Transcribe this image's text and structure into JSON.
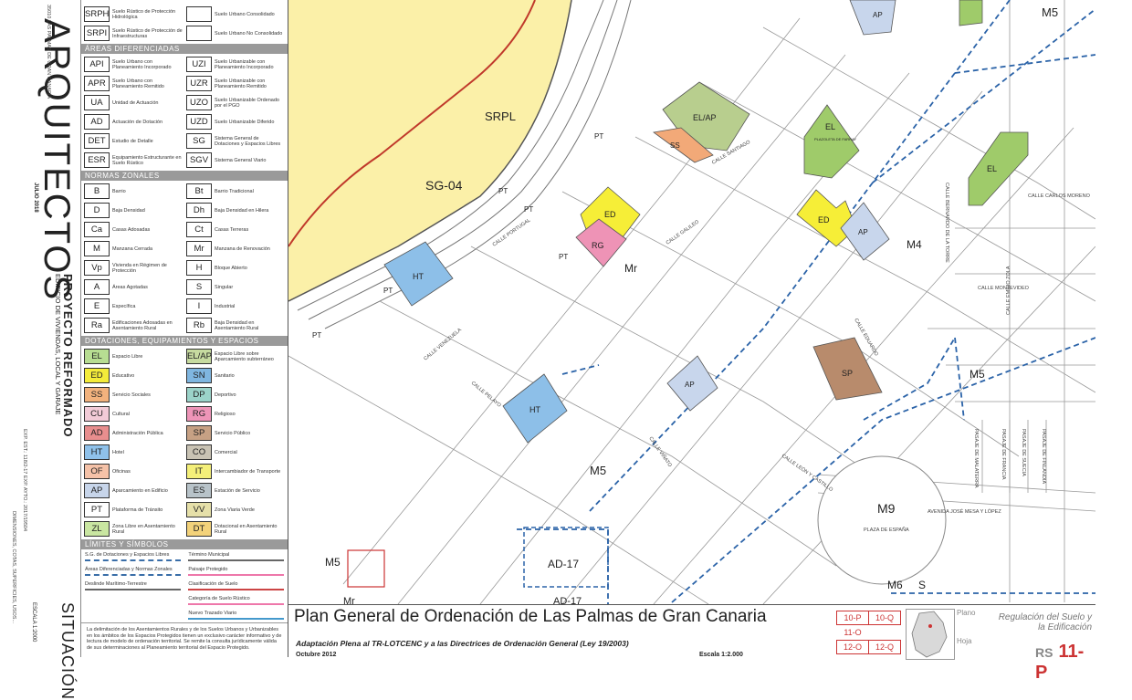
{
  "strip": {
    "brand": "ARQUITECTOS",
    "project": "PROYECTO REFORMADO",
    "building": "EDIFICIO DE VIVIENDAS, LOCAL Y GARAJE",
    "address": "35010 LAS PALMAS DE GRAN CANARIA",
    "date": "JULIO 2018",
    "file": "EXP. EST.: 118/2-17   EXP. AYTO.: 2017/19504",
    "measures": "DIMENSIONES, COTAS, SUPERFICIES, USOS...",
    "situacion": "SITUACIÓN",
    "scale": "ESCALA 1:2000"
  },
  "legend": {
    "top_rows": [
      {
        "code": "SRPH",
        "desc": "Suelo Rústico de Protección Hidrológica",
        "code2": "",
        "desc2": "Suelo Urbano Consolidado",
        "color2": "#ffffff"
      },
      {
        "code": "SRPI",
        "desc": "Suelo Rústico de Protección de Infraestructuras",
        "code2": "",
        "desc2": "Suelo Urbano No Consolidado",
        "color2": "#ffffff"
      }
    ],
    "areas_header": "Áreas Diferenciadas",
    "areas": [
      {
        "code": "API",
        "desc": "Suelo Urbano con Planeamiento Incorporado"
      },
      {
        "code": "UZI",
        "desc": "Suelo Urbanizable con Planeamiento Incorporado"
      },
      {
        "code": "APR",
        "desc": "Suelo Urbano con Planeamiento Remitido"
      },
      {
        "code": "UZR",
        "desc": "Suelo Urbanizable con Planeamiento Remitido"
      },
      {
        "code": "UA",
        "desc": "Unidad de Actuación"
      },
      {
        "code": "UZO",
        "desc": "Suelo Urbanizable Ordenado por el PGO"
      },
      {
        "code": "AD",
        "desc": "Actuación de Dotación"
      },
      {
        "code": "UZD",
        "desc": "Suelo Urbanizable Diferido"
      },
      {
        "code": "DET",
        "desc": "Estudio de Detalle"
      },
      {
        "code": "SG",
        "desc": "Sistema General de Dotaciones y Espacios Libres"
      },
      {
        "code": "ESR",
        "desc": "Equipamiento Estructurante en Suelo Rústico"
      },
      {
        "code": "SGV",
        "desc": "Sistema General Viario"
      }
    ],
    "normas_header": "Normas Zonales",
    "normas": [
      {
        "code": "B",
        "desc": "Barrio"
      },
      {
        "code": "Bt",
        "desc": "Barrio Tradicional"
      },
      {
        "code": "D",
        "desc": "Baja Densidad"
      },
      {
        "code": "Dh",
        "desc": "Baja Densidad en Hilera"
      },
      {
        "code": "Ca",
        "desc": "Casas Adosadas"
      },
      {
        "code": "Ct",
        "desc": "Casas Terreras"
      },
      {
        "code": "M",
        "desc": "Manzana Cerrada"
      },
      {
        "code": "Mr",
        "desc": "Manzana de Renovación"
      },
      {
        "code": "Vp",
        "desc": "Vivienda en Régimen de Protección"
      },
      {
        "code": "H",
        "desc": "Bloque Abierto"
      },
      {
        "code": "A",
        "desc": "Áreas Agotadas"
      },
      {
        "code": "S",
        "desc": "Singular"
      },
      {
        "code": "E",
        "desc": "Específica"
      },
      {
        "code": "I",
        "desc": "Industrial"
      },
      {
        "code": "Ra",
        "desc": "Edificaciones Adosadas en Asentamiento Rural"
      },
      {
        "code": "Rb",
        "desc": "Baja Densidad en Asentamiento Rural"
      }
    ],
    "dotaciones_header": "Dotaciones, Equipamientos y Espacios Libres",
    "dotaciones": [
      {
        "code": "EL",
        "desc": "Espacio Libre",
        "color": "#b7dd92"
      },
      {
        "code": "EL/AP",
        "desc": "Espacio Libre sobre Aparcamiento subterráneo",
        "color": "#c7dba0"
      },
      {
        "code": "ED",
        "desc": "Educativo",
        "color": "#f4ec3a"
      },
      {
        "code": "SN",
        "desc": "Sanitario",
        "color": "#7fb6e0"
      },
      {
        "code": "SS",
        "desc": "Servicio Sociales",
        "color": "#f2b27d"
      },
      {
        "code": "DP",
        "desc": "Deportivo",
        "color": "#9bd3c9"
      },
      {
        "code": "CU",
        "desc": "Cultural",
        "color": "#f2cbd7"
      },
      {
        "code": "RG",
        "desc": "Religioso",
        "color": "#ee95b8"
      },
      {
        "code": "AD",
        "desc": "Administración Pública",
        "color": "#e88e8e"
      },
      {
        "code": "SP",
        "desc": "Servicio Público",
        "color": "#c7a184"
      },
      {
        "code": "HT",
        "desc": "Hotel",
        "color": "#8fc1ea"
      },
      {
        "code": "CO",
        "desc": "Comercial",
        "color": "#c9c3b4"
      },
      {
        "code": "OF",
        "desc": "Oficinas",
        "color": "#f5c2a8"
      },
      {
        "code": "IT",
        "desc": "Intercambiador de Transporte",
        "color": "#f4ef79"
      },
      {
        "code": "AP",
        "desc": "Aparcamiento en Edificio",
        "color": "#c7d5ea"
      },
      {
        "code": "ES",
        "desc": "Estación de Servicio",
        "color": "#b8c3c9"
      },
      {
        "code": "PT",
        "desc": "Plataforma de Tránsito",
        "color": "#ffffff"
      },
      {
        "code": "VV",
        "desc": "Zona Viaria Verde",
        "color": "#e6e0a9"
      },
      {
        "code": "ZL",
        "desc": "Zona Libre en Asentamiento Rural",
        "color": "#c9e6a1"
      },
      {
        "code": "DT",
        "desc": "Dotacional en Asentamiento Rural",
        "color": "#f3d27a"
      }
    ],
    "simbolos_header": "Límites y Símbolos",
    "simbolos": [
      [
        "S.G. de Dotaciones y Espacios Libres",
        "Término Municipal",
        "Cambio de Alineación"
      ],
      [
        "Áreas Diferenciadas y Normas Zonales",
        "Paisaje Protegido",
        "Catálogo Municipal"
      ],
      [
        "Deslinde Marítimo-Terrestre",
        "Clasificación de Suelo",
        "Monumento Natural"
      ],
      [
        "",
        "Categoría de Suelo Rústico",
        "Nueva Alineación"
      ],
      [
        "",
        "Nuevo Trazado Viario",
        ""
      ]
    ],
    "note": "La delimitación de los Asentamientos Rurales y de los Suelos Urbanos y Urbanizables en los ámbitos de los Espacios Protegidos tienen un exclusivo carácter informativo y de lectura de modelo de ordenación territorial. Se remite la consulta jurídicamente válida de sus determinaciones al Planeamiento territorial del Espacio Protegido."
  },
  "map": {
    "zones": {
      "srpl": "SRPL",
      "sg04": "SG-04",
      "elap": "EL/AP",
      "ss": "SS",
      "el1": "EL",
      "el1_sub": "PLAZOLETA DE FARRAY",
      "el2": "EL",
      "ed1": "ED",
      "rg": "RG",
      "ed2": "ED",
      "ap1": "AP",
      "ap2": "AP",
      "ap3": "AP",
      "ht1": "HT",
      "ht2": "HT",
      "sp": "SP",
      "pt1": "PT",
      "pt2": "PT",
      "pt3": "PT",
      "pt4": "PT",
      "pt5": "PT",
      "pt6": "PT",
      "ad17": "AD-17",
      "ad17b": "AD-17"
    },
    "normas": {
      "m5_top": "M5",
      "m5_right": "M5",
      "m5_center": "M5",
      "m5_bottom": "M5",
      "m4": "M4",
      "mr": "Mr",
      "m9": "M9",
      "m6": "M6",
      "s": "S",
      "mr_bottom": "Mr"
    },
    "streets": {
      "portugal": "CALLE PORTUGAL",
      "galileo": "CALLE GALILEO",
      "cristobal": "CALLE SANTIAGO",
      "eduardo": "CALLE EDUARDO",
      "montevideo": "CALLE MONTEVIDEO",
      "zola": "CALLE EMILIO ZOLA",
      "vinatto": "CALLE VIÑATO",
      "leon": "CALLE LEÓN Y CASTILLO",
      "avenida": "AVENIDA JOSÉ MESA Y LÓPEZ",
      "plaza": "PLAZA DE ESPAÑA",
      "malaterra": "PASAJE DE MALATERRA",
      "francia": "PASAJE DE FRANCIA",
      "suecia": "PASAJE DE SUECIA",
      "finlandia": "PASAJE DE FINLANDIA",
      "pelayo": "CALLE PELAYO",
      "venezuela": "CALLE VENEZUELA",
      "bernardo": "CALLE BERNARDO DE LA TORRE",
      "carlos": "CALLE CARLOS MORENO"
    }
  },
  "titleblock": {
    "title": "Plan General de Ordenación de Las Palmas de Gran Canaria",
    "subtitle": "Adaptación Plena al TR-LOTCENC y a las Directrices de Ordenación General (Ley 19/2003)",
    "date": "Octubre 2012",
    "scale": "Escala 1:2.000",
    "sheets": [
      "10-P",
      "10-Q",
      "11-O",
      "",
      "12-O",
      "12-Q"
    ],
    "plano_label": "Plano",
    "hoja_label": "Hoja",
    "regulacion": "Regulación del Suelo y la Edificación",
    "code_prefix": "RS",
    "code": "11-P"
  }
}
